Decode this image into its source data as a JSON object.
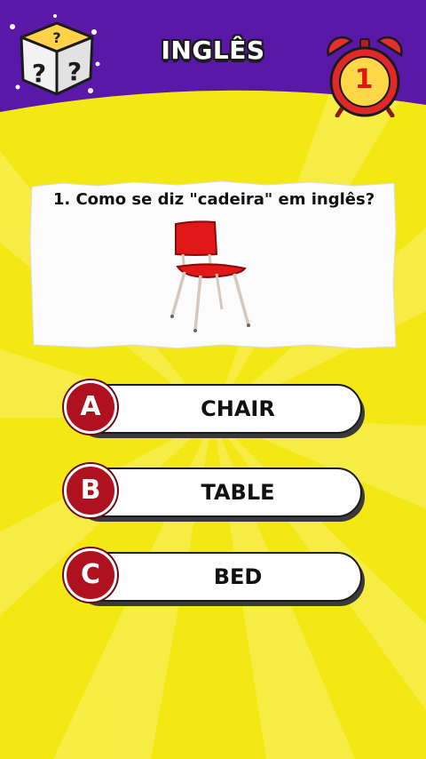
{
  "header": {
    "title": "INGLÊS",
    "timer_value": "1",
    "purple_color": "#5a18a8",
    "yellow_color": "#f4e814"
  },
  "icons": {
    "dice": "mystery-dice-icon",
    "clock": "alarm-clock-icon",
    "chair": "red-chair-image"
  },
  "question": {
    "text": "1. Como se diz \"cadeira\" em inglês?"
  },
  "options": [
    {
      "letter": "A",
      "label": "CHAIR"
    },
    {
      "letter": "B",
      "label": "TABLE"
    },
    {
      "letter": "C",
      "label": "BED"
    }
  ]
}
